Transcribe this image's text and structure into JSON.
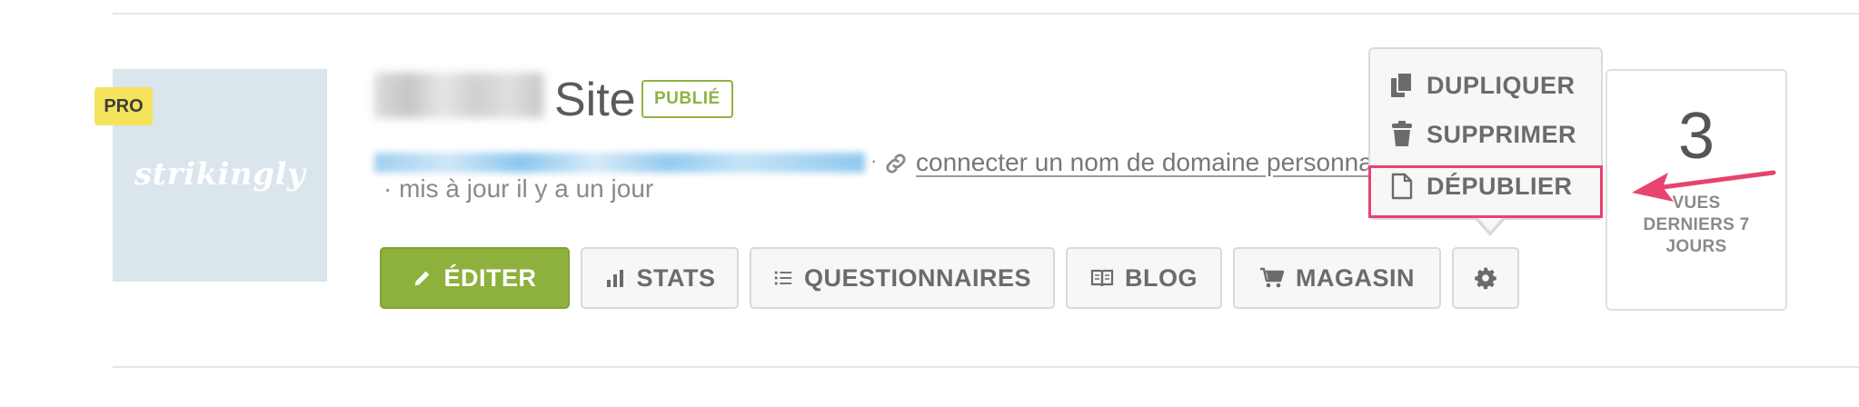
{
  "site": {
    "pro_badge": "PRO",
    "thumbnail_logo": "strikingly",
    "title": "Site",
    "status": "PUBLIÉ",
    "connect_domain_link": "connecter un nom de domaine personnalisé",
    "updated": "· mis à jour il y a un jour",
    "separator": "·"
  },
  "actions": {
    "edit": "ÉDITER",
    "stats": "STATS",
    "forms": "QUESTIONNAIRES",
    "blog": "BLOG",
    "shop": "MAGASIN"
  },
  "menu": {
    "duplicate": "DUPLIQUER",
    "delete": "SUPPRIMER",
    "unpublish": "DÉPUBLIER"
  },
  "views": {
    "count": "3",
    "label_line1": "VUES",
    "label_line2": "DERNIERS 7",
    "label_line3": "JOURS"
  },
  "colors": {
    "accent_green": "#8db13c",
    "highlight_pink": "#e8436e",
    "pro_yellow": "#f5e35c"
  },
  "icons": [
    "pencil-icon",
    "bar-chart-icon",
    "list-icon",
    "book-icon",
    "cart-icon",
    "gear-icon",
    "copy-icon",
    "trash-icon",
    "file-icon",
    "link-icon",
    "arrow-icon"
  ]
}
